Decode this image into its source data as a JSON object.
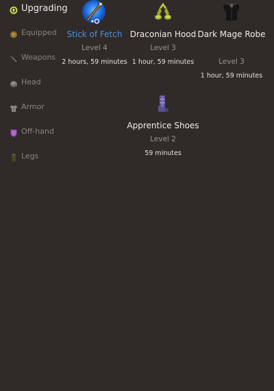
{
  "sidebar": {
    "items": [
      {
        "label": "Upgrading",
        "icon": "upgrade-icon",
        "active": true
      },
      {
        "label": "Equipped",
        "icon": "equipped-icon"
      },
      {
        "label": "Weapons",
        "icon": "weapons-icon"
      },
      {
        "label": "Head",
        "icon": "head-icon"
      },
      {
        "label": "Armor",
        "icon": "armor-icon"
      },
      {
        "label": "Off-hand",
        "icon": "off-hand-icon"
      },
      {
        "label": "Legs",
        "icon": "legs-icon"
      }
    ]
  },
  "items": [
    {
      "name": "Stick of Fetch",
      "level": "Level 4",
      "time": "2 hours, 59 minutes",
      "icon": "stick-of-fetch-icon",
      "highlight": true
    },
    {
      "name": "Draconian Hood",
      "level": "Level 3",
      "time": "1 hour, 59 minutes",
      "icon": "draconian-hood-icon"
    },
    {
      "name": "Dark Mage Robe",
      "level": "Level 3",
      "time": "1 hour, 59 minutes",
      "icon": "dark-mage-robe-icon"
    },
    {
      "name": "Apprentice Shoes",
      "level": "Level 2",
      "time": "59 minutes",
      "icon": "apprentice-shoes-icon"
    }
  ],
  "colors": {
    "background": "#302b29",
    "highlight": "#4a90e2",
    "text": "#f0ece8",
    "muted": "#8a8480"
  }
}
